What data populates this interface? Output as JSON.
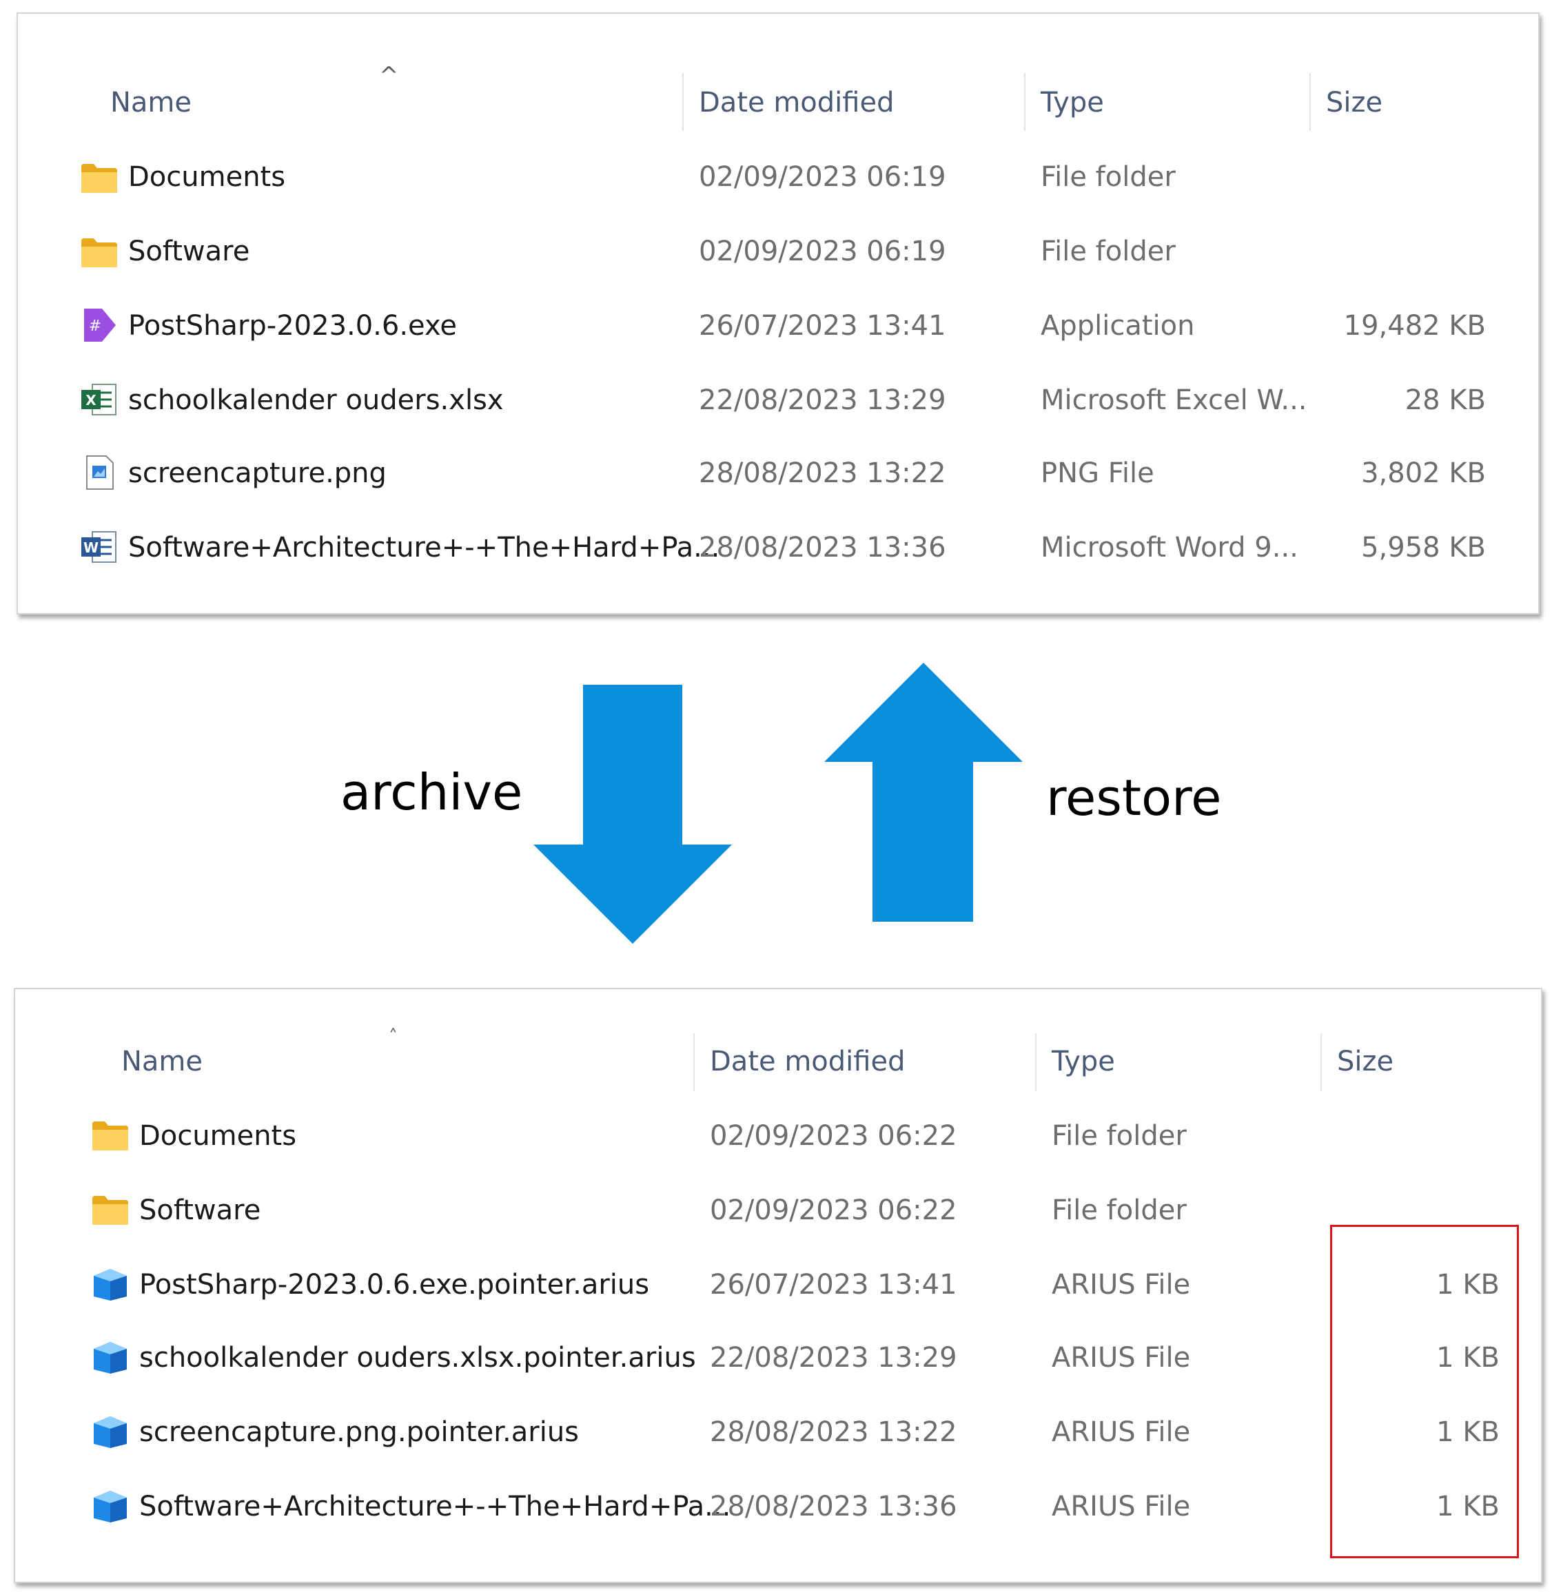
{
  "colors": {
    "arrow": "#0a8fdc",
    "highlight": "#e0141a",
    "folder": "#f5c542",
    "header_text": "#4a5a75"
  },
  "top_pane": {
    "headers": {
      "name": "Name",
      "date": "Date modified",
      "type": "Type",
      "size": "Size"
    },
    "sort_indicator": "^",
    "rows": [
      {
        "icon": "folder-icon",
        "name": "Documents",
        "date": "02/09/2023 06:19",
        "type": "File folder",
        "size": ""
      },
      {
        "icon": "folder-icon",
        "name": "Software",
        "date": "02/09/2023 06:19",
        "type": "File folder",
        "size": ""
      },
      {
        "icon": "postsharp-icon",
        "name": "PostSharp-2023.0.6.exe",
        "date": "26/07/2023 13:41",
        "type": "Application",
        "size": "19,482 KB"
      },
      {
        "icon": "excel-icon",
        "name": "schoolkalender ouders.xlsx",
        "date": "22/08/2023 13:29",
        "type": "Microsoft Excel W...",
        "size": "28 KB"
      },
      {
        "icon": "image-file-icon",
        "name": "screencapture.png",
        "date": "28/08/2023 13:22",
        "type": "PNG File",
        "size": "3,802 KB"
      },
      {
        "icon": "word-icon",
        "name": "Software+Architecture+-+The+Hard+Pa...",
        "date": "28/08/2023 13:36",
        "type": "Microsoft Word 9...",
        "size": "5,958 KB"
      }
    ]
  },
  "arrows": {
    "archive_label": "archive",
    "restore_label": "restore"
  },
  "bottom_pane": {
    "headers": {
      "name": "Name",
      "date": "Date modified",
      "type": "Type",
      "size": "Size"
    },
    "sort_indicator": "˄",
    "rows": [
      {
        "icon": "folder-icon",
        "name": "Documents",
        "date": "02/09/2023 06:22",
        "type": "File folder",
        "size": ""
      },
      {
        "icon": "folder-icon",
        "name": "Software",
        "date": "02/09/2023 06:22",
        "type": "File folder",
        "size": ""
      },
      {
        "icon": "arius-file-icon",
        "name": "PostSharp-2023.0.6.exe.pointer.arius",
        "date": "26/07/2023 13:41",
        "type": "ARIUS File",
        "size": "1 KB"
      },
      {
        "icon": "arius-file-icon",
        "name": "schoolkalender ouders.xlsx.pointer.arius",
        "date": "22/08/2023 13:29",
        "type": "ARIUS File",
        "size": "1 KB"
      },
      {
        "icon": "arius-file-icon",
        "name": "screencapture.png.pointer.arius",
        "date": "28/08/2023 13:22",
        "type": "ARIUS File",
        "size": "1 KB"
      },
      {
        "icon": "arius-file-icon",
        "name": "Software+Architecture+-+The+Hard+Pa...",
        "date": "28/08/2023 13:36",
        "type": "ARIUS File",
        "size": "1 KB"
      }
    ]
  }
}
